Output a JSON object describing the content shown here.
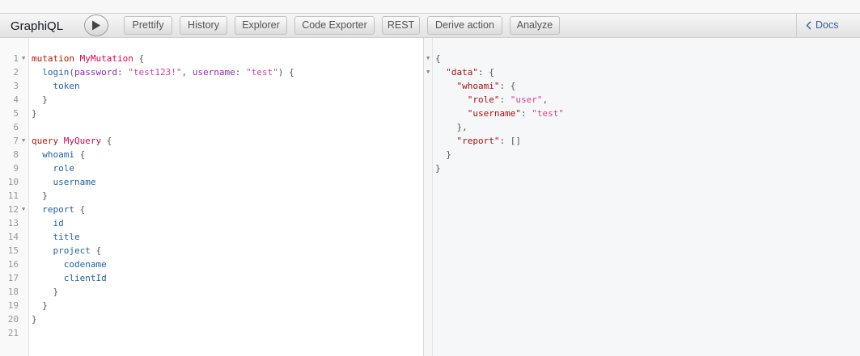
{
  "app": {
    "title": "GraphiQL",
    "buttons": [
      "Prettify",
      "History",
      "Explorer",
      "Code Exporter",
      "REST",
      "Derive action",
      "Analyze"
    ],
    "docs_label": "Docs"
  },
  "icons": {
    "play": "play-icon",
    "docs": "chevron-left-icon",
    "fold": "fold-arrow-icon"
  },
  "colors": {
    "keyword": "#b11a04",
    "definition": "#d2054e",
    "property": "#1f61a0",
    "attribute": "#8b2bb9",
    "string": "#d64292",
    "link": "#3b5998"
  },
  "editor": {
    "line_numbers": [
      "1",
      "2",
      "3",
      "4",
      "5",
      "6",
      "7",
      "8",
      "9",
      "10",
      "11",
      "12",
      "13",
      "14",
      "15",
      "16",
      "17",
      "18",
      "19",
      "20",
      "21"
    ],
    "fold_lines": [
      "1",
      "7",
      "12"
    ],
    "lines": [
      [
        [
          "kw",
          "mutation "
        ],
        [
          "def",
          "MyMutation"
        ],
        [
          "punc",
          " {"
        ]
      ],
      [
        [
          "punc",
          "  "
        ],
        [
          "prop",
          "login"
        ],
        [
          "punc",
          "("
        ],
        [
          "attr",
          "password"
        ],
        [
          "punc",
          ": "
        ],
        [
          "str",
          "\"test123!\""
        ],
        [
          "punc",
          ", "
        ],
        [
          "attr",
          "username"
        ],
        [
          "punc",
          ": "
        ],
        [
          "str",
          "\"test\""
        ],
        [
          "punc",
          ") {"
        ]
      ],
      [
        [
          "punc",
          "    "
        ],
        [
          "prop",
          "token"
        ]
      ],
      [
        [
          "punc",
          "  }"
        ]
      ],
      [
        [
          "punc",
          "}"
        ]
      ],
      [],
      [
        [
          "kw",
          "query "
        ],
        [
          "def",
          "MyQuery"
        ],
        [
          "punc",
          " {"
        ]
      ],
      [
        [
          "punc",
          "  "
        ],
        [
          "prop",
          "whoami"
        ],
        [
          "punc",
          " {"
        ]
      ],
      [
        [
          "punc",
          "    "
        ],
        [
          "prop",
          "role"
        ]
      ],
      [
        [
          "punc",
          "    "
        ],
        [
          "prop",
          "username"
        ]
      ],
      [
        [
          "punc",
          "  }"
        ]
      ],
      [
        [
          "punc",
          "  "
        ],
        [
          "prop",
          "report"
        ],
        [
          "punc",
          " {"
        ]
      ],
      [
        [
          "punc",
          "    "
        ],
        [
          "prop",
          "id"
        ]
      ],
      [
        [
          "punc",
          "    "
        ],
        [
          "prop",
          "title"
        ]
      ],
      [
        [
          "punc",
          "    "
        ],
        [
          "prop",
          "project"
        ],
        [
          "punc",
          " {"
        ]
      ],
      [
        [
          "punc",
          "      "
        ],
        [
          "prop",
          "codename"
        ]
      ],
      [
        [
          "punc",
          "      "
        ],
        [
          "prop",
          "clientId"
        ]
      ],
      [
        [
          "punc",
          "    }"
        ]
      ],
      [
        [
          "punc",
          "  }"
        ]
      ],
      [
        [
          "punc",
          "}"
        ]
      ],
      []
    ]
  },
  "results": {
    "lines": [
      [
        [
          "punc",
          "{"
        ]
      ],
      [
        [
          "punc",
          "  "
        ],
        [
          "rkey",
          "\"data\""
        ],
        [
          "punc",
          ": {"
        ]
      ],
      [
        [
          "punc",
          "    "
        ],
        [
          "rkey",
          "\"whoami\""
        ],
        [
          "punc",
          ": {"
        ]
      ],
      [
        [
          "punc",
          "      "
        ],
        [
          "rkey",
          "\"role\""
        ],
        [
          "punc",
          ": "
        ],
        [
          "rstr",
          "\"user\""
        ],
        [
          "punc",
          ","
        ]
      ],
      [
        [
          "punc",
          "      "
        ],
        [
          "rkey",
          "\"username\""
        ],
        [
          "punc",
          ": "
        ],
        [
          "rstr",
          "\"test\""
        ]
      ],
      [
        [
          "punc",
          "    },"
        ]
      ],
      [
        [
          "punc",
          "    "
        ],
        [
          "rkey",
          "\"report\""
        ],
        [
          "punc",
          ": []"
        ]
      ],
      [
        [
          "punc",
          "  }"
        ]
      ],
      [
        [
          "punc",
          "}"
        ]
      ]
    ]
  }
}
